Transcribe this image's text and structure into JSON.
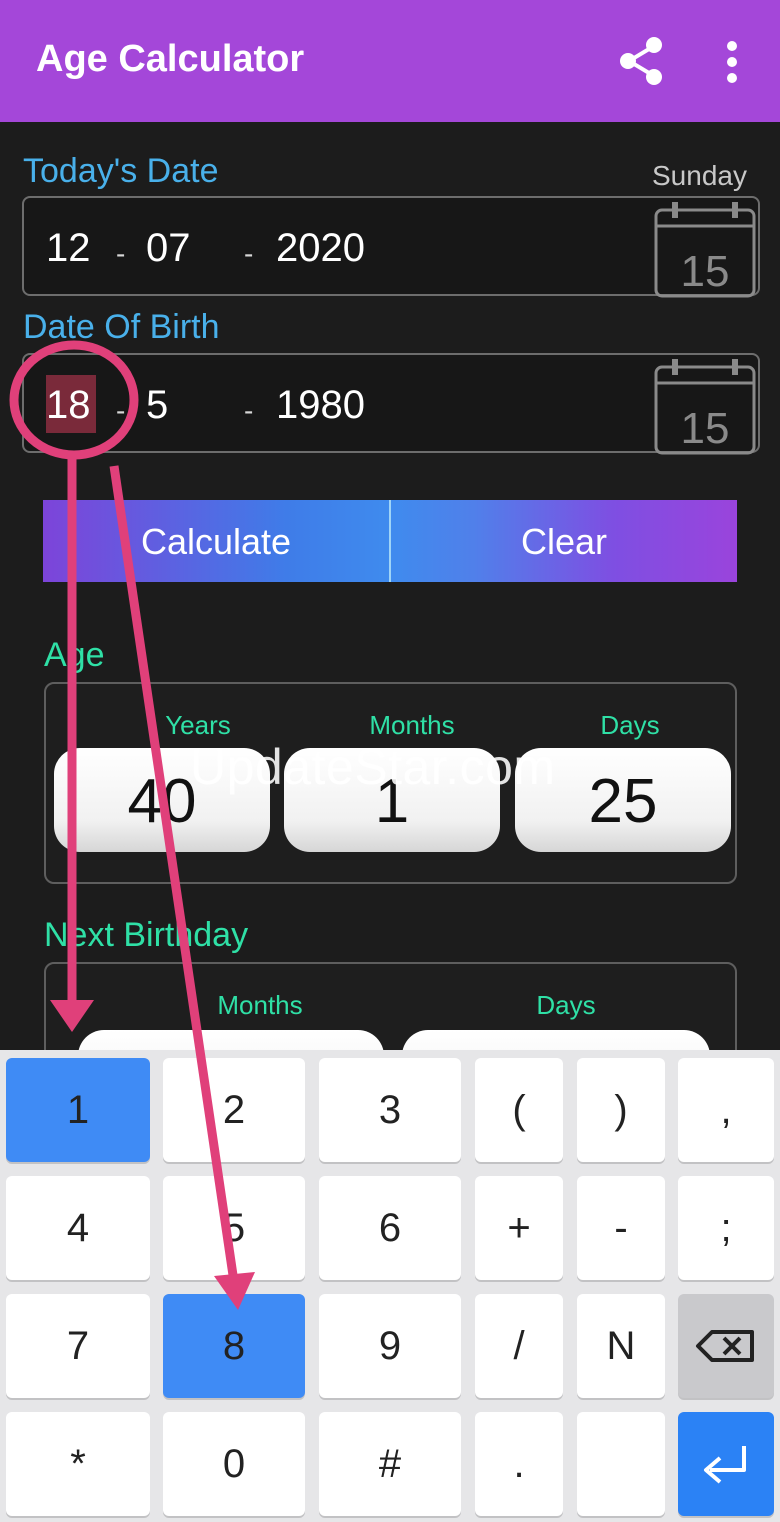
{
  "app": {
    "title": "Age Calculator"
  },
  "todays_date": {
    "label": "Today's Date",
    "weekday": "Sunday",
    "day": "12",
    "month": "07",
    "year": "2020",
    "sep": "-"
  },
  "date_of_birth": {
    "label": "Date Of Birth",
    "day": "18",
    "month": "5",
    "year": "1980",
    "sep": "-"
  },
  "calendar_icon_number": "15",
  "buttons": {
    "calculate": "Calculate",
    "clear": "Clear"
  },
  "age": {
    "label": "Age",
    "columns": [
      "Years",
      "Months",
      "Days"
    ],
    "values": [
      "40",
      "1",
      "25"
    ]
  },
  "next_birthday": {
    "label": "Next Birthday",
    "columns": [
      "Months",
      "Days"
    ]
  },
  "watermark": "UpdateStar.com",
  "keyboard": {
    "rows": [
      [
        "1",
        "2",
        "3",
        "(",
        ")",
        ","
      ],
      [
        "4",
        "5",
        "6",
        "+",
        "-",
        ";"
      ],
      [
        "7",
        "8",
        "9",
        "/",
        "N",
        "backspace"
      ],
      [
        "*",
        "0",
        "#",
        ".",
        "",
        "enter"
      ]
    ],
    "highlighted": [
      "1",
      "8"
    ]
  },
  "colors": {
    "app_bar": "#a447d9",
    "label_blue": "#49b0ea",
    "label_green": "#2fe0a6",
    "annotation": "#e0407a",
    "key_highlight": "#3f8bf5"
  }
}
